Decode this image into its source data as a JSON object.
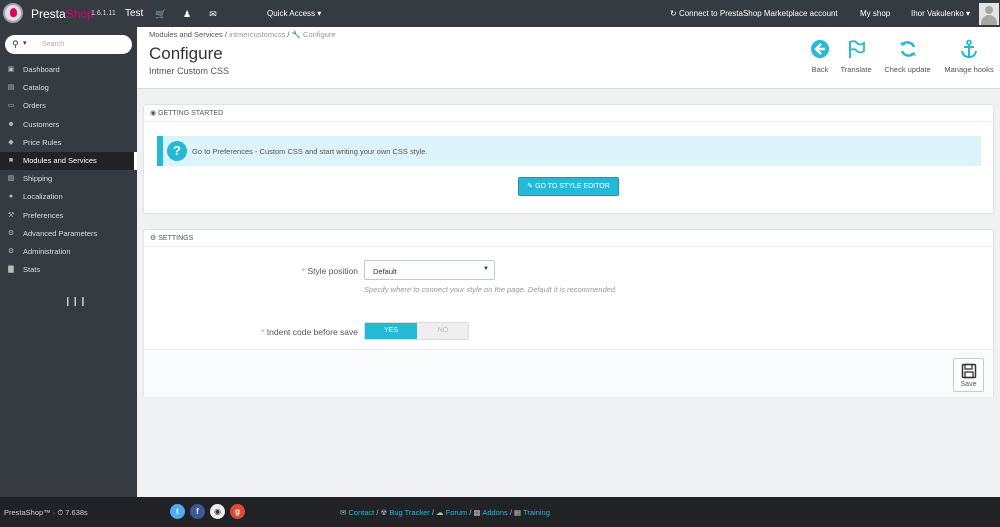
{
  "topbar": {
    "brand_presta": "Presta",
    "brand_shop": "Shop",
    "version": "1.6.1.11",
    "shop_name": "Test",
    "quick_access": "Quick Access ▾",
    "connect": "Connect to PrestaShop Marketplace account",
    "my_shop": "My shop",
    "user": "Ihor Vakulenko ▾"
  },
  "sidebar": {
    "search_placeholder": "Search",
    "items": [
      {
        "label": "Dashboard",
        "icon": "▣"
      },
      {
        "label": "Catalog",
        "icon": "▤"
      },
      {
        "label": "Orders",
        "icon": "▭"
      },
      {
        "label": "Customers",
        "icon": "☻"
      },
      {
        "label": "Price Rules",
        "icon": "◆"
      },
      {
        "label": "Modules and Services",
        "icon": "■"
      },
      {
        "label": "Shipping",
        "icon": "▨"
      },
      {
        "label": "Localization",
        "icon": "●"
      },
      {
        "label": "Preferences",
        "icon": "⚒"
      },
      {
        "label": "Advanced Parameters",
        "icon": "⚙"
      },
      {
        "label": "Administration",
        "icon": "⚙"
      },
      {
        "label": "Stats",
        "icon": "▇"
      }
    ]
  },
  "header": {
    "crumb_1": "Modules and Services",
    "crumb_sep": " / ",
    "crumb_2": "intmercustomcss",
    "crumb_3": "Configure",
    "title": "Configure",
    "subtitle": "Intmer Custom CSS",
    "toolbar": {
      "back": "Back",
      "translate": "Translate",
      "check_update": "Check update",
      "manage_hooks": "Manage hooks"
    }
  },
  "getting_started": {
    "heading": "GETTING STARTED",
    "alert_text": "Go to Preferences - Custom CSS and start writing your own CSS style.",
    "button": "GO TO STYLE EDITOR"
  },
  "settings": {
    "heading": "SETTINGS",
    "style_position_label": "Style position",
    "style_position_value": "Default",
    "style_position_help": "Specify where to connect your style on the page. Default it is recommended.",
    "indent_label": "Indent code before save",
    "yes": "YES",
    "no": "NO",
    "save": "Save"
  },
  "footer": {
    "version": "PrestaShop™ · ⏱ 7.638s",
    "contact": "Contact",
    "bug_tracker": "Bug Tracker",
    "forum": "Forum",
    "addons": "Addons",
    "training": "Training"
  },
  "colors": {
    "accent": "#25b9d7",
    "sidebar": "#363a41",
    "brand_pink": "#df0067"
  }
}
